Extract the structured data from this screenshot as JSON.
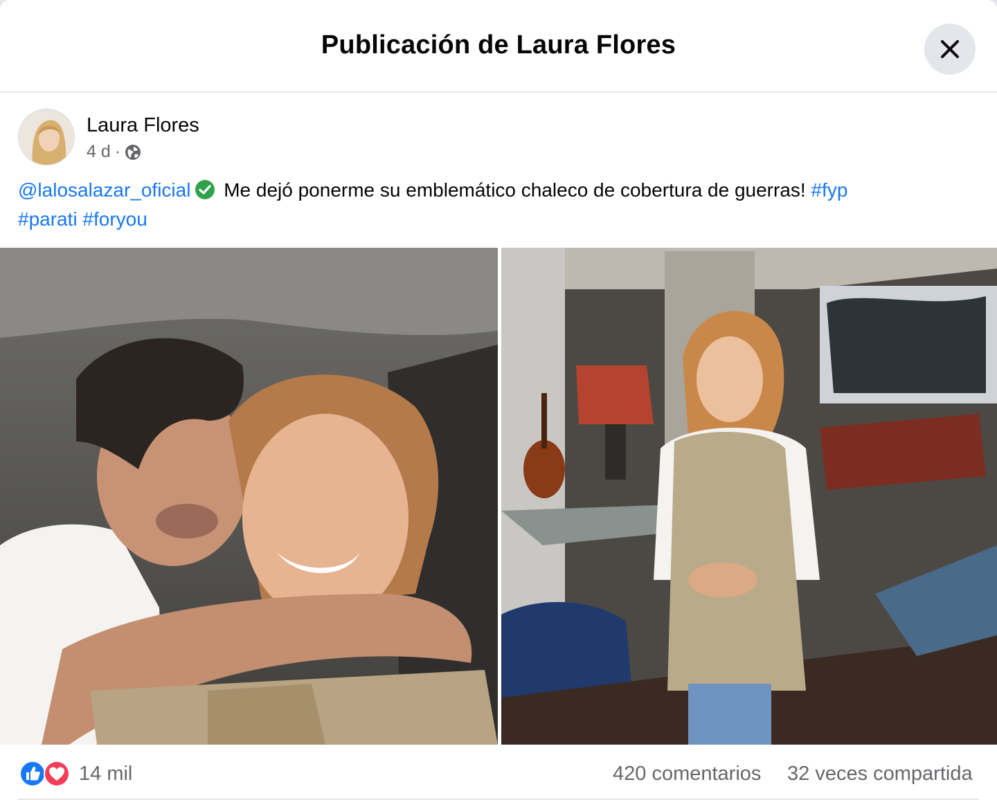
{
  "dialog": {
    "title": "Publicación de Laura Flores",
    "close_icon": "close-icon"
  },
  "post": {
    "author": "Laura Flores",
    "time": "4 d",
    "separator": "·",
    "audience_icon": "globe-icon",
    "text": {
      "mention": "@lalosalazar_oficial",
      "body": " Me dejó ponerme su emblemático chaleco de cobertura de guerras! ",
      "hashtags": [
        "#fyp",
        "#parati",
        "#foryou"
      ]
    },
    "photos": [
      {
        "icon": "photo-selfie"
      },
      {
        "icon": "photo-standing"
      }
    ]
  },
  "stats": {
    "reaction_icons": [
      "like-icon",
      "love-icon"
    ],
    "reactions": "14 mil",
    "comments": "420 comentarios",
    "shares": "32 veces compartida"
  },
  "colors": {
    "link": "#1877f2",
    "secondary_text": "#65676b",
    "verified": "#31a24c",
    "like": "#1877f2",
    "love": "#f33e58"
  }
}
